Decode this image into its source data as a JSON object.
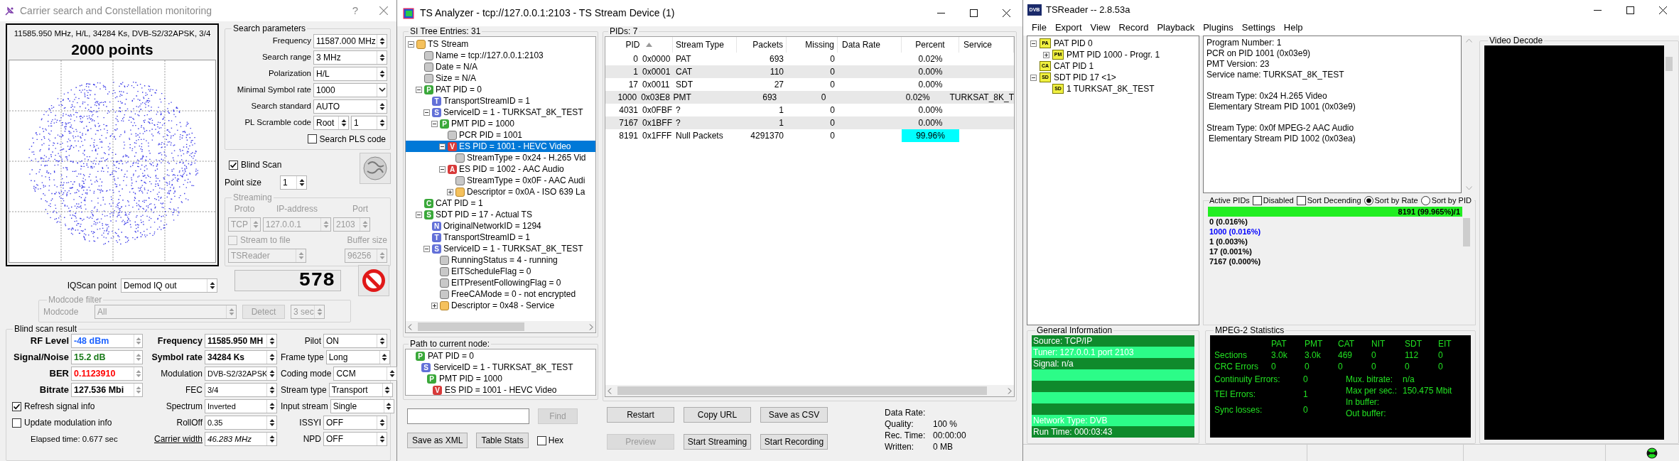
{
  "carrier_window": {
    "title": "Carrier search and Constellation monitoring",
    "help": "?",
    "constellation": {
      "caption": "11585.950 MHz, H/L, 34284 Ks, DVB-S2/32APSK, 3/4",
      "points": "2000 points"
    },
    "search_parameters": {
      "title": "Search parameters",
      "fields": [
        {
          "label": "Frequency",
          "value": "11587.000 MHz",
          "kind": "spin"
        },
        {
          "label": "Search range",
          "value": "3 MHz",
          "kind": "combo"
        },
        {
          "label": "Polarization",
          "value": "H/L",
          "kind": "combo"
        },
        {
          "label": "Minimal Symbol rate",
          "value": "1000",
          "kind": "dropdown"
        },
        {
          "label": "Search standard",
          "value": "AUTO",
          "kind": "combo"
        }
      ],
      "pl_scramble": {
        "label": "PL Scramble code",
        "mode": "Root",
        "code": "1"
      },
      "search_pls": {
        "label": "Search PLS code",
        "checked": false
      }
    },
    "blind_scan": {
      "label": "Blind Scan",
      "checked": true
    },
    "point_size": {
      "label": "Point size",
      "value": "1"
    },
    "streaming": {
      "title": "Streaming",
      "disabled": true,
      "proto_label": "Proto",
      "ip_label": "IP-address",
      "port_label": "Port",
      "proto": "TCP",
      "ip": "127.0.0.1",
      "port": "2103",
      "stream_to_file": {
        "label": "Stream to file",
        "checked": false
      },
      "buffer_label": "Buffer size",
      "target": "TSReader",
      "buffer": "96256"
    },
    "counter": "578",
    "iqscan": {
      "label": "IQScan point",
      "value": "Demod IQ out"
    },
    "modcode_filter": {
      "title": "Modcode filter",
      "disabled": true,
      "label": "Modcode",
      "value": "All",
      "detect": "Detect",
      "interval": "3 sec"
    },
    "result": {
      "title": "Blind scan result",
      "signal": [
        {
          "label": "RF Level",
          "value": "-48 dBm",
          "color": "#1e64ff"
        },
        {
          "label": "Signal/Noise",
          "value": "15.2 dB",
          "color": "#1a7a1a"
        },
        {
          "label": "BER",
          "value": "0.1123910",
          "color": "#ff0000"
        },
        {
          "label": "Bitrate",
          "value": "127.536 Mbi",
          "color": "#000000"
        }
      ],
      "options": [
        {
          "label": "Refresh signal info",
          "checked": true
        },
        {
          "label": "Update modulation info",
          "checked": false
        }
      ],
      "elapsed": "Elapsed time: 0.677 sec",
      "modulation": [
        {
          "label": "Frequency",
          "value": "11585.950 MH",
          "kind": "readout"
        },
        {
          "label": "Symbol rate",
          "value": "34284 Ks",
          "kind": "readout"
        },
        {
          "label": "Modulation",
          "value": "DVB-S2/32APSK",
          "kind": "combo"
        },
        {
          "label": "FEC",
          "value": "3/4",
          "kind": "combo"
        },
        {
          "label": "Spectrum",
          "value": "Inverted",
          "kind": "combo"
        },
        {
          "label": "RollOff",
          "value": "0.35",
          "kind": "combo"
        },
        {
          "label": "Carrier width",
          "value": "46.283 MHz",
          "kind": "link"
        }
      ],
      "frame": [
        {
          "label": "Pilot",
          "value": "ON"
        },
        {
          "label": "Frame type",
          "value": "Long"
        },
        {
          "label": "Coding mode",
          "value": "CCM"
        },
        {
          "label": "Stream type",
          "value": "Transport"
        },
        {
          "label": "Input stream",
          "value": "Single"
        },
        {
          "label": "ISSYI",
          "value": "OFF"
        },
        {
          "label": "NPD",
          "value": "OFF"
        }
      ]
    }
  },
  "analyzer_window": {
    "title": "TS Analyzer - tcp://127.0.0.1:2103 - TS Stream Device (1)",
    "tree": {
      "title": "SI Tree Entries: 31",
      "nodes": [
        {
          "label": "TS Stream",
          "kind": "folder",
          "expanded": true,
          "selected": false,
          "children": [
            {
              "label": "Name = tcp://127.0.0.1:2103",
              "kind": "leaf",
              "selected": false
            },
            {
              "label": "Date = N/A",
              "kind": "leaf",
              "selected": false
            },
            {
              "label": "Size = N/A",
              "kind": "leaf",
              "selected": false
            },
            {
              "label": "PAT PID = 0",
              "kind": "badge",
              "letter": "P",
              "color": "#3aa83a",
              "expanded": true,
              "selected": false,
              "children": [
                {
                  "label": "TransportStreamID = 1",
                  "kind": "badge",
                  "letter": "T",
                  "color": "#6270d8",
                  "selected": false
                },
                {
                  "label": "ServiceID = 1 - TURKSAT_8K_TEST",
                  "kind": "badge",
                  "letter": "S",
                  "color": "#6270d8",
                  "expanded": true,
                  "selected": false,
                  "children": [
                    {
                      "label": "PMT PID = 1000",
                      "kind": "badge",
                      "letter": "P",
                      "color": "#3aa83a",
                      "expanded": true,
                      "selected": false,
                      "children": [
                        {
                          "label": "PCR PID = 1001",
                          "kind": "leaf",
                          "selected": false
                        },
                        {
                          "label": "ES PID = 1001 - HEVC Video",
                          "kind": "badge",
                          "letter": "V",
                          "color": "#d83a3a",
                          "expanded": true,
                          "selected": true,
                          "children": [
                            {
                              "label": "StreamType = 0x24 - H.265 Vid",
                              "kind": "leaf",
                              "selected": false
                            }
                          ]
                        },
                        {
                          "label": "ES PID = 1002 - AAC Audio",
                          "kind": "badge",
                          "letter": "A",
                          "color": "#d83a3a",
                          "expanded": true,
                          "selected": false,
                          "children": [
                            {
                              "label": "StreamType = 0x0F - AAC Audi",
                              "kind": "leaf",
                              "selected": false
                            },
                            {
                              "label": "Descriptor = 0x0A - ISO 639 La",
                              "kind": "folder",
                              "expanded": false,
                              "selected": false
                            }
                          ]
                        }
                      ]
                    }
                  ]
                }
              ]
            },
            {
              "label": "CAT PID = 1",
              "kind": "badge",
              "letter": "C",
              "color": "#3aa83a",
              "selected": false
            },
            {
              "label": "SDT PID = 17 - Actual TS",
              "kind": "badge",
              "letter": "S",
              "color": "#3aa83a",
              "expanded": true,
              "selected": false,
              "children": [
                {
                  "label": "OriginalNetworkID = 1294",
                  "kind": "badge",
                  "letter": "N",
                  "color": "#6270d8",
                  "selected": false
                },
                {
                  "label": "TransportStreamID = 1",
                  "kind": "badge",
                  "letter": "T",
                  "color": "#6270d8",
                  "selected": false
                },
                {
                  "label": "ServiceID = 1 - TURKSAT_8K_TEST",
                  "kind": "badge",
                  "letter": "S",
                  "color": "#6270d8",
                  "expanded": true,
                  "selected": false,
                  "children": [
                    {
                      "label": "RunningStatus = 4 - running",
                      "kind": "leaf",
                      "selected": false
                    },
                    {
                      "label": "EITScheduleFlag = 0",
                      "kind": "leaf",
                      "selected": false
                    },
                    {
                      "label": "EITPresentFollowingFlag = 0",
                      "kind": "leaf",
                      "selected": false
                    },
                    {
                      "label": "FreeCAMode = 0 - not encrypted",
                      "kind": "leaf",
                      "selected": false
                    },
                    {
                      "label": "Descriptor = 0x48 - Service",
                      "kind": "folder",
                      "expanded": false,
                      "selected": false
                    }
                  ]
                }
              ]
            }
          ]
        }
      ]
    },
    "path": {
      "title": "Path to current node:",
      "nodes": [
        {
          "label": "PAT PID = 0",
          "letter": "P",
          "color": "#3aa83a",
          "children": [
            {
              "label": "ServiceID = 1 - TURKSAT_8K_TEST",
              "letter": "S",
              "color": "#6270d8",
              "children": [
                {
                  "label": "PMT PID = 1000",
                  "letter": "P",
                  "color": "#3aa83a",
                  "children": [
                    {
                      "label": "ES PID = 1001 - HEVC Video",
                      "letter": "V",
                      "color": "#d83a3a"
                    }
                  ]
                }
              ]
            }
          ]
        }
      ]
    },
    "find": {
      "button": "Find",
      "disabled": true
    },
    "actions": [
      "Save as XML",
      "Table Stats"
    ],
    "hex": {
      "label": "Hex",
      "checked": false
    },
    "pids": {
      "title": "PIDs: 7",
      "columns": [
        {
          "label": "PID",
          "sorted": true
        },
        {
          "label": "Stream Type",
          "sorted": false
        },
        {
          "label": "Packets",
          "sorted": false
        },
        {
          "label": "Missing",
          "sorted": false
        },
        {
          "label": "Data Rate",
          "sorted": false
        },
        {
          "label": "Percent",
          "sorted": false
        },
        {
          "label": "Service",
          "sorted": false
        }
      ],
      "rows": [
        {
          "pid": "0",
          "hex": "0x0000",
          "type": "PAT",
          "packets": "693",
          "missing": "0",
          "percent": "0.02%",
          "highlight": false
        },
        {
          "pid": "1",
          "hex": "0x0001",
          "type": "CAT",
          "packets": "110",
          "missing": "0",
          "percent": "0.00%",
          "highlight": false
        },
        {
          "pid": "17",
          "hex": "0x0011",
          "type": "SDT",
          "packets": "27",
          "missing": "0",
          "percent": "0.00%",
          "highlight": false
        },
        {
          "pid": "1000",
          "hex": "0x03E8",
          "type": "PMT",
          "packets": "693",
          "missing": "0",
          "percent": "0.02%",
          "service": "TURKSAT_8K_T",
          "highlight": false
        },
        {
          "pid": "4031",
          "hex": "0x0FBF",
          "type": "?",
          "packets": "1",
          "missing": "0",
          "percent": "0.00%",
          "highlight": false
        },
        {
          "pid": "7167",
          "hex": "0x1BFF",
          "type": "?",
          "packets": "1",
          "missing": "0",
          "percent": "0.00%",
          "highlight": false
        },
        {
          "pid": "8191",
          "hex": "0x1FFF",
          "type": "Null Packets",
          "packets": "4291370",
          "missing": "0",
          "percent": "99.96%",
          "highlight": true
        }
      ]
    },
    "buttons": [
      {
        "label": "Restart",
        "disabled": false
      },
      {
        "label": "Copy URL",
        "disabled": false
      },
      {
        "label": "Save as CSV",
        "disabled": false
      },
      {
        "label": "Preview",
        "disabled": true
      },
      {
        "label": "Start Streaming",
        "disabled": false
      },
      {
        "label": "Start Recording",
        "disabled": false
      }
    ],
    "stats": [
      {
        "label": "Data Rate:"
      },
      {
        "label": "Quality:",
        "value": "100 %"
      },
      {
        "label": "Rec. Time:",
        "value": "00:00:00"
      },
      {
        "label": "Written:",
        "value": "0 MB"
      }
    ]
  },
  "tsreader_window": {
    "title": "TSReader -- 2.8.53a",
    "logo": "DVB",
    "menu": [
      "File",
      "Export",
      "View",
      "Record",
      "Playback",
      "Plugins",
      "Settings",
      "Help"
    ],
    "tree": [
      {
        "tag": "PA",
        "label": "PAT PID 0",
        "expanded": true,
        "children": [
          {
            "tag": "PM",
            "label": "PMT PID 1000 - Progr. 1",
            "expanded": false
          }
        ]
      },
      {
        "tag": "CA",
        "label": "CAT PID 1"
      },
      {
        "tag": "SD",
        "label": "SDT PID 17 <1>",
        "expanded": true,
        "children": [
          {
            "tag": "SD",
            "label": "1 TURKSAT_8K_TEST"
          }
        ]
      }
    ],
    "info": [
      [
        "Program Number: 1",
        "PCR on PID 1001 (0x03e9)",
        "PMT Version: 23",
        "Service name: TURKSAT_8K_TEST"
      ],
      [
        "Stream Type: 0x24 H.265 Video",
        "Elementary Stream PID 1001 (0x03e9)"
      ],
      [
        "Stream Type: 0x0f MPEG-2 AAC Audio",
        "Elementary Stream PID 1002 (0x03ea)"
      ]
    ],
    "active_pids": {
      "title": "Active PIDs",
      "options": [
        {
          "label": "Disabled",
          "checked": false
        },
        {
          "label": "Sort Decending",
          "checked": false
        }
      ],
      "sort": [
        {
          "label": "Sort by Rate",
          "selected": true
        },
        {
          "label": "Sort by PID",
          "selected": false
        }
      ],
      "items": [
        {
          "text": "8191 (99.965%)/1",
          "level": 0.99965
        },
        {
          "text": "0 (0.016%)",
          "color": "#000000"
        },
        {
          "text": "1000 (0.016%)",
          "color": "#0000ff"
        },
        {
          "text": "1 (0.003%)",
          "color": "#000000"
        },
        {
          "text": "17 (0.001%)",
          "color": "#000000"
        },
        {
          "text": "7167 (0.000%)",
          "color": "#000000"
        }
      ]
    },
    "video": {
      "title": "Video Decode"
    },
    "general": {
      "title": "General Information",
      "top": [
        "Source: TCP/IP",
        "Tuner: 127.0.0.1 port 2103",
        "Signal: n/a"
      ],
      "bottom": [
        "Network Type: DVB",
        "Run Time: 000:03:43"
      ]
    },
    "mpeg": {
      "title": "MPEG-2 Statistics",
      "columns": [
        "PAT",
        "PMT",
        "CAT",
        "NIT",
        "SDT",
        "EIT"
      ],
      "rows": [
        {
          "label": "Sections",
          "values": [
            "3.0k",
            "3.0k",
            "469",
            "0",
            "112",
            "0"
          ]
        },
        {
          "label": "CRC Errors",
          "values": [
            "0",
            "0",
            "0",
            "0",
            "0",
            "0"
          ]
        }
      ],
      "left": [
        {
          "label": "Continuity Errors:",
          "value": "0"
        },
        {
          "label": "TEI Errors:",
          "value": "1"
        },
        {
          "label": "Sync losses:",
          "value": "0"
        }
      ],
      "right": [
        {
          "label": "Mux. bitrate:",
          "value": "n/a"
        },
        {
          "label": "Max per sec.:",
          "value": "150.475 Mbit"
        },
        {
          "label": "In buffer:"
        },
        {
          "label": "Out buffer:"
        }
      ]
    }
  }
}
